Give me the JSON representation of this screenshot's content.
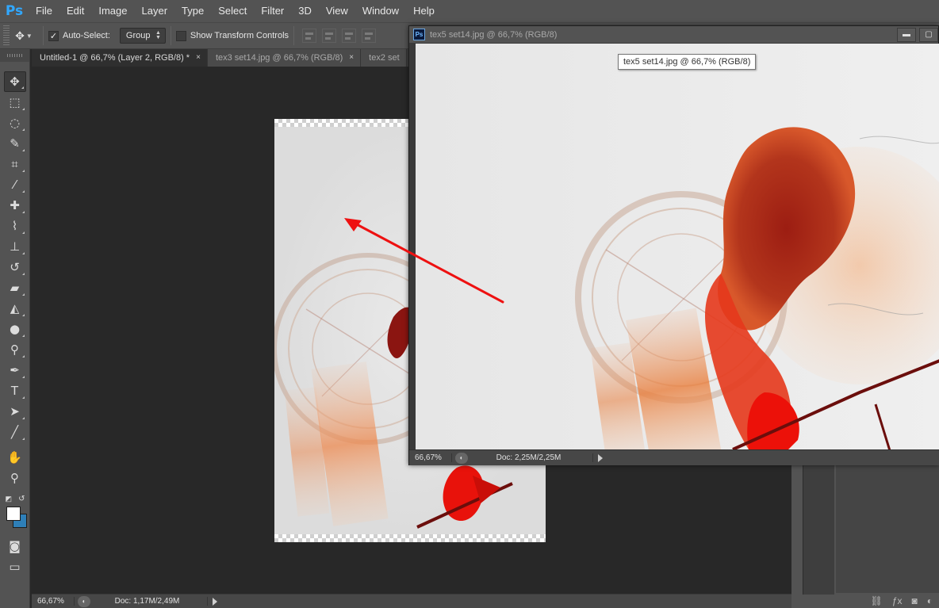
{
  "app": {
    "logo": "Ps"
  },
  "menu": [
    "File",
    "Edit",
    "Image",
    "Layer",
    "Type",
    "Select",
    "Filter",
    "3D",
    "View",
    "Window",
    "Help"
  ],
  "options": {
    "auto_select_label": "Auto-Select:",
    "auto_select_checked": true,
    "group_value": "Group",
    "transform_label": "Show Transform Controls",
    "transform_checked": false
  },
  "tabs": [
    {
      "label": "Untitled-1 @ 66,7% (Layer 2, RGB/8) *",
      "close": "×"
    },
    {
      "label": "tex3 set14.jpg @ 66,7% (RGB/8)",
      "close": "×"
    },
    {
      "label": "tex2 set",
      "close": ""
    }
  ],
  "status_main": {
    "zoom": "66,67%",
    "doc": "Doc: 1,17M/2,49M"
  },
  "float_window": {
    "icon": "Ps",
    "title": "tex5 set14.jpg @ 66,7% (RGB/8)",
    "tooltip": "tex5 set14.jpg @ 66,7% (RGB/8)",
    "minimize": "▬",
    "maximize": "▢",
    "zoom": "66,67%",
    "doc": "Doc: 2,25M/2,25M"
  },
  "tools": [
    "move-tool",
    "marquee-tool",
    "lasso-tool",
    "quick-selection-tool",
    "crop-tool",
    "eyedropper-tool",
    "healing-brush-tool",
    "brush-tool",
    "clone-stamp-tool",
    "history-brush-tool",
    "eraser-tool",
    "paint-bucket-tool",
    "blur-tool",
    "dodge-tool",
    "pen-tool",
    "type-tool",
    "path-selection-tool",
    "line-tool",
    "hand-tool",
    "zoom-tool"
  ],
  "colors": {
    "foreground": "#ffffff",
    "background": "#2e7fb8",
    "annotation_arrow": "#ee1111",
    "accent": "#31a8ff"
  }
}
